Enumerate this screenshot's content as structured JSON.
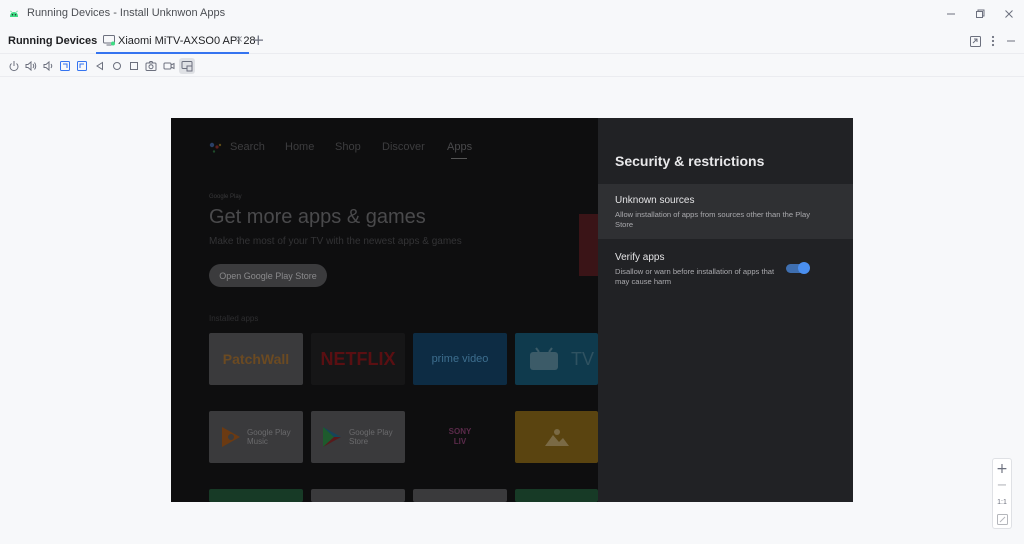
{
  "window": {
    "title": "Running Devices - Install Unknwon Apps",
    "controls": [
      "minimize-icon",
      "restore-icon",
      "close-icon"
    ]
  },
  "tabbar": {
    "panel_title": "Running Devices",
    "tab_label": "Xiaomi MiTV-AXSO0 API 28",
    "close_glyph": "×",
    "add_glyph": "+"
  },
  "toolbar": {
    "icons": [
      "power-icon",
      "volume-up-icon",
      "volume-down-icon",
      "rotate-left-icon",
      "rotate-right-icon",
      "back-icon",
      "home-icon",
      "overview-icon",
      "screenshot-icon",
      "screen-record-icon",
      "device-mirror-icon"
    ],
    "active": "device-mirror-icon"
  },
  "tv": {
    "nav": [
      "Search",
      "Home",
      "Shop",
      "Discover",
      "Apps"
    ],
    "active_nav": "Apps",
    "badge": "Google Play",
    "headline": "Get more apps & games",
    "subtitle": "Make the most of your TV with the newest apps & games",
    "button": "Open Google Play Store",
    "section": "Installed apps",
    "tiles_row1": [
      "PatchWall",
      "NETFLIX",
      "prime video",
      "TV"
    ],
    "tiles_row2": [
      "Google Play Music",
      "Google Play Store",
      "SONY LIV",
      ""
    ]
  },
  "panel": {
    "heading": "Security & restrictions",
    "options": [
      {
        "title": "Unknown sources",
        "desc": "Allow installation of apps from sources other than the Play Store",
        "selected": true
      },
      {
        "title": "Verify apps",
        "desc": "Disallow or warn before installation of apps that may cause harm",
        "toggle": true
      }
    ]
  },
  "zoom": {
    "zoom_in": "+",
    "zoom_out": "−",
    "actual_size": "1:1",
    "fit": "fit-screen-icon"
  },
  "colors": {
    "accent": "#3574f0",
    "toggle_on": "#4a8ff0",
    "panel_bg": "#212225",
    "selected_bg": "#2f3033"
  }
}
